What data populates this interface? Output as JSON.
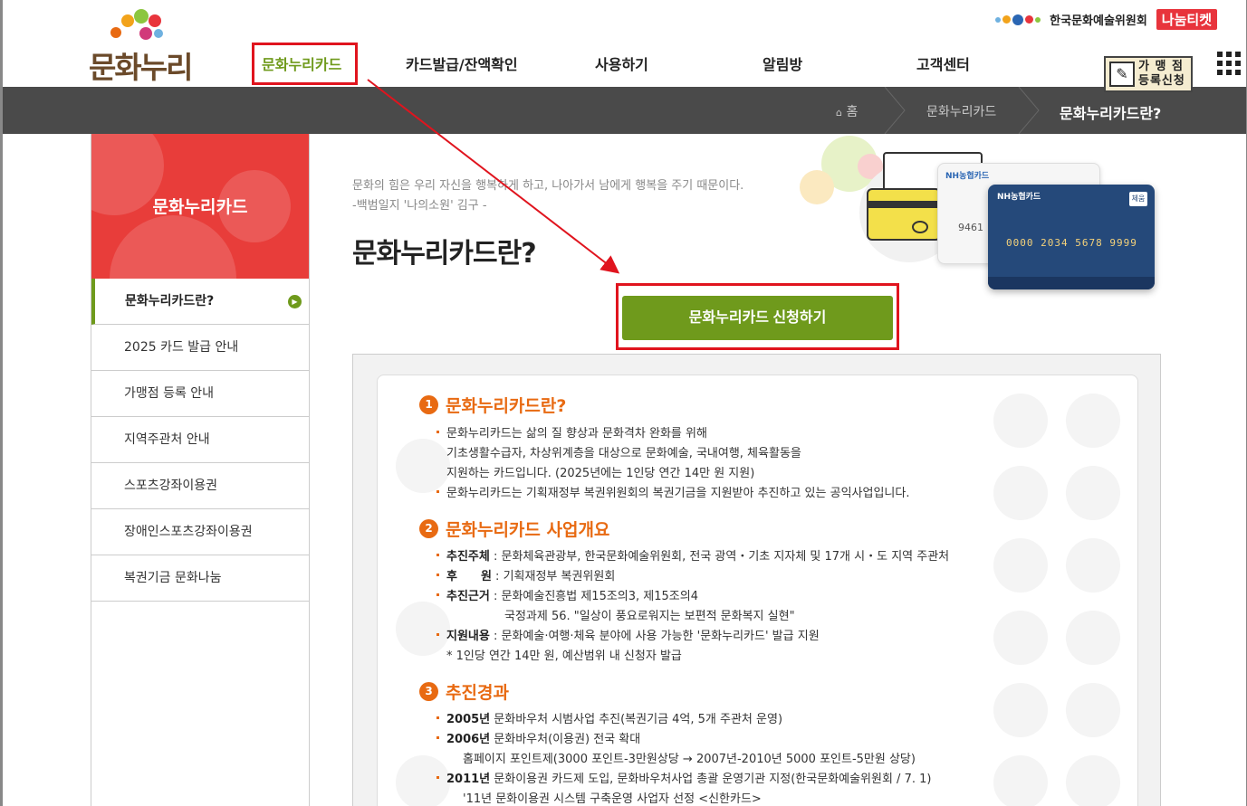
{
  "logo": {
    "text": "문화누리"
  },
  "top_right": {
    "org": "한국문화예술위원회",
    "ticket": "나눔티켓"
  },
  "gnb": [
    {
      "label": "문화누리카드"
    },
    {
      "label": "카드발급/잔액확인"
    },
    {
      "label": "사용하기"
    },
    {
      "label": "알림방"
    },
    {
      "label": "고객센터"
    }
  ],
  "merchant": {
    "line1": "가 맹 점",
    "line2": "등록신청"
  },
  "breadcrumb": {
    "home": "홈",
    "level1": "문화누리카드",
    "current": "문화누리카드란?"
  },
  "sidebar": {
    "title": "문화누리카드",
    "items": [
      {
        "label": "문화누리카드란?"
      },
      {
        "label": "2025 카드 발급 안내"
      },
      {
        "label": "가맹점 등록 안내"
      },
      {
        "label": "지역주관처 안내"
      },
      {
        "label": "스포츠강좌이용권"
      },
      {
        "label": "장애인스포츠강좌이용권"
      },
      {
        "label": "복권기금 문화나눔"
      }
    ]
  },
  "quote": {
    "line1": "문화의 힘은 우리 자신을 행복하게 하고, 나아가서 남에게 행복을 주기 때문이다.",
    "line2": "-백범일지 '나의소원' 김구 -"
  },
  "page_title": "문화누리카드란?",
  "apply_button": "문화누리카드 신청하기",
  "cards": {
    "brand": "NH농협카드",
    "number": "0000 2034 5678 9999",
    "badge": "체움",
    "front_number": "9461"
  },
  "sections": [
    {
      "num": "1",
      "title": "문화누리카드란?",
      "lines": [
        "문화누리카드는 삶의 질 향상과 문화격차 완화를 위해",
        "기초생활수급자, 차상위계층을 대상으로 문화예술, 국내여행, 체육활동을",
        "지원하는 카드입니다. (2025년에는 1인당 연간 14만 원 지원)",
        "문화누리카드는 기획재정부 복권위원회의 복권기금을 지원받아 추진하고 있는 공익사업입니다."
      ]
    },
    {
      "num": "2",
      "title": "문화누리카드 사업개요",
      "rows": [
        {
          "label": "추진주체",
          "text": " : 문화체육관광부, 한국문화예술위원회, 전국 광역・기초 지자체 및 17개 시・도 지역 주관처"
        },
        {
          "label": "후　　원",
          "text": " : 기획재정부 복권위원회"
        },
        {
          "label": "추진근거",
          "text": " : 문화예술진흥법 제15조의3, 제15조의4"
        },
        {
          "label": "",
          "text": "국정과제 56. \"일상이 풍요로워지는 보편적 문화복지 실현\""
        },
        {
          "label": "지원내용",
          "text": " : 문화예술·여행·체육 분야에 사용 가능한 '문화누리카드' 발급 지원"
        },
        {
          "label": "",
          "text": "* 1인당 연간 14만 원, 예산범위 내 신청자 발급"
        }
      ]
    },
    {
      "num": "3",
      "title": "추진경과",
      "rows": [
        {
          "label": "2005년",
          "text": " 문화바우처 시범사업 추진(복권기금 4억, 5개 주관처 운영)"
        },
        {
          "label": "2006년",
          "text": " 문화바우처(이용권) 전국 확대"
        },
        {
          "label": "",
          "text": "홈페이지 포인트제(3000 포인트-3만원상당 → 2007년-2010년 5000 포인트-5만원 상당)"
        },
        {
          "label": "2011년",
          "text": " 문화이용권 카드제 도입, 문화바우처사업 총괄 운영기관 지정(한국문화예술위원회 / 7. 1)"
        },
        {
          "label": "",
          "text": "'11년 문화이용권 시스템 구축운영 사업자 선정 <신한카드>"
        }
      ]
    }
  ]
}
